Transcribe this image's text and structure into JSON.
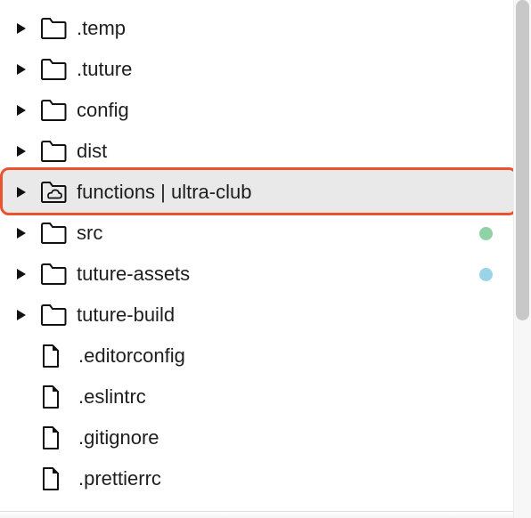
{
  "tree": {
    "folders": [
      {
        "label": ".temp",
        "icon": "folder-icon"
      },
      {
        "label": ".tuture",
        "icon": "folder-icon"
      },
      {
        "label": "config",
        "icon": "folder-icon"
      },
      {
        "label": "dist",
        "icon": "folder-icon"
      },
      {
        "label": "functions | ultra-club",
        "icon": "cloud-folder-icon",
        "selected": true
      },
      {
        "label": "src",
        "icon": "folder-icon",
        "status_color": "#8fd3a4"
      },
      {
        "label": "tuture-assets",
        "icon": "folder-icon",
        "status_color": "#9ad4e6"
      },
      {
        "label": "tuture-build",
        "icon": "folder-icon"
      }
    ],
    "files": [
      {
        "label": ".editorconfig",
        "icon": "file-icon"
      },
      {
        "label": ".eslintrc",
        "icon": "file-icon"
      },
      {
        "label": ".gitignore",
        "icon": "file-icon"
      },
      {
        "label": ".prettierrc",
        "icon": "file-icon"
      }
    ]
  },
  "colors": {
    "highlight_border": "#e9532f",
    "selected_background": "#e9e9e9"
  }
}
